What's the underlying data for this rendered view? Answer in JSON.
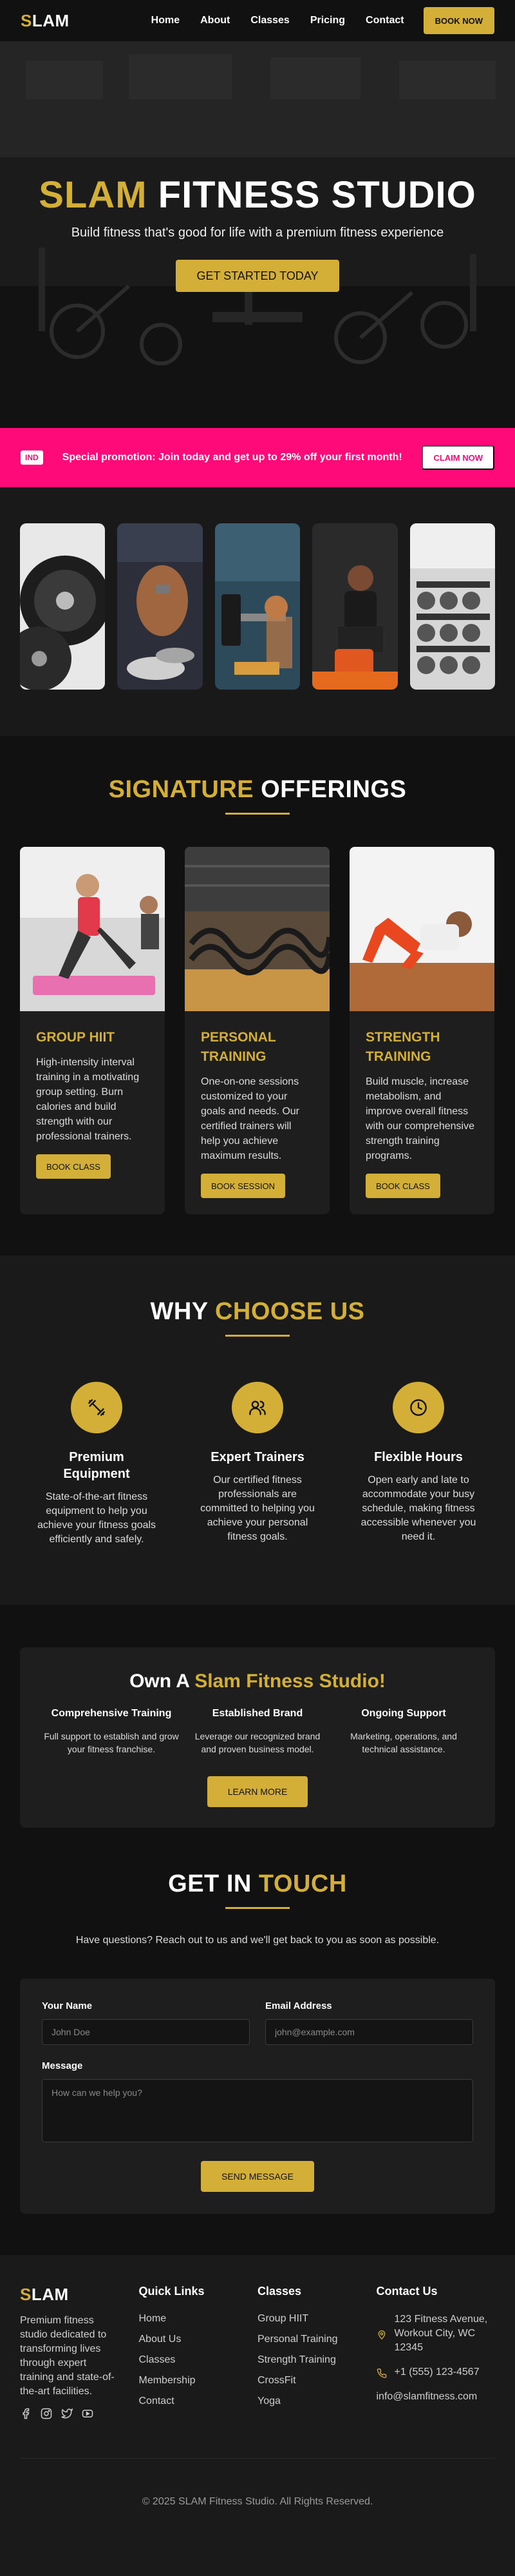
{
  "nav": {
    "logo_s": "S",
    "logo_rest": "LAM",
    "links": [
      "Home",
      "About",
      "Classes",
      "Pricing",
      "Contact"
    ],
    "cta": "BOOK NOW"
  },
  "hero": {
    "title_accent": "SLAM",
    "title_rest": "FITNESS STUDIO",
    "subtitle": "Build fitness that's good for life with a premium fitness experience",
    "cta": "GET STARTED TODAY"
  },
  "promo": {
    "badge": "IND",
    "text": "Special promotion: Join today and get up to 29% off your first month!",
    "cta": "CLAIM NOW"
  },
  "offerings": {
    "title_accent": "SIGNATURE",
    "title_rest": "OFFERINGS",
    "cards": [
      {
        "title": "GROUP HIIT",
        "text": "High-intensity interval training in a motivating group setting. Burn calories and build strength with our professional trainers.",
        "cta": "BOOK CLASS"
      },
      {
        "title": "PERSONAL TRAINING",
        "text": "One-on-one sessions customized to your goals and needs. Our certified trainers will help you achieve maximum results.",
        "cta": "BOOK SESSION"
      },
      {
        "title": "STRENGTH TRAINING",
        "text": "Build muscle, increase metabolism, and improve overall fitness with our comprehensive strength training programs.",
        "cta": "BOOK CLASS"
      }
    ]
  },
  "why": {
    "title_rest": "WHY",
    "title_accent": "CHOOSE US",
    "features": [
      {
        "icon": "dumbbell-icon",
        "title": "Premium Equipment",
        "text": "State-of-the-art fitness equipment to help you achieve your fitness goals efficiently and safely."
      },
      {
        "icon": "users-icon",
        "title": "Expert Trainers",
        "text": "Our certified fitness professionals are committed to helping you achieve your personal fitness goals."
      },
      {
        "icon": "clock-icon",
        "title": "Flexible Hours",
        "text": "Open early and late to accommodate your busy schedule, making fitness accessible whenever you need it."
      }
    ]
  },
  "franchise": {
    "title_rest": "Own A",
    "title_accent": "Slam Fitness Studio!",
    "cols": [
      {
        "title": "Comprehensive Training",
        "text": "Full support to establish and grow your fitness franchise."
      },
      {
        "title": "Established Brand",
        "text": "Leverage our recognized brand and proven business model."
      },
      {
        "title": "Ongoing Support",
        "text": "Marketing, operations, and technical assistance."
      }
    ],
    "cta": "LEARN MORE"
  },
  "contact": {
    "title_rest": "GET IN",
    "title_accent": "TOUCH",
    "subtitle": "Have questions? Reach out to us and we'll get back to you as soon as possible.",
    "name_label": "Your Name",
    "name_placeholder": "John Doe",
    "email_label": "Email Address",
    "email_placeholder": "john@example.com",
    "message_label": "Message",
    "message_placeholder": "How can we help you?",
    "cta": "SEND MESSAGE"
  },
  "footer": {
    "about": "Premium fitness studio dedicated to transforming lives through expert training and state-of-the-art facilities.",
    "quick_links_title": "Quick Links",
    "quick_links": [
      "Home",
      "About Us",
      "Classes",
      "Membership",
      "Contact"
    ],
    "classes_title": "Classes",
    "classes": [
      "Group HIIT",
      "Personal Training",
      "Strength Training",
      "CrossFit",
      "Yoga"
    ],
    "contact_title": "Contact Us",
    "address": "123 Fitness Avenue, Workout City, WC 12345",
    "phone": "+1 (555) 123-4567",
    "email": "info@slamfitness.com",
    "copyright": "© 2025 SLAM Fitness Studio. All Rights Reserved."
  },
  "colors": {
    "accent": "#d4af37",
    "promo": "#ff0a78",
    "background": "#111111",
    "panel": "#1e1e1e"
  }
}
